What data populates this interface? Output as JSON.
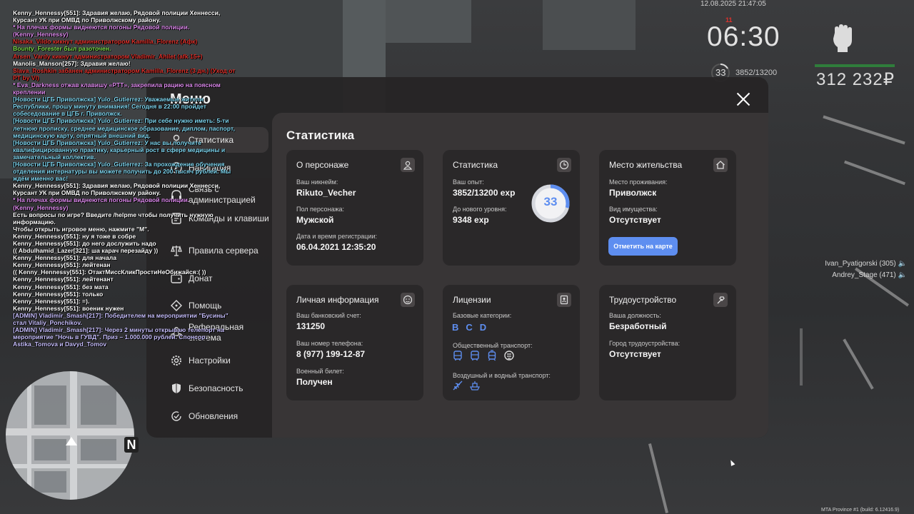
{
  "chat": [
    {
      "text": "Kenny_Hennessy[551]: Здравия желаю, Рядовой полиции Хеннесси, Курсант УК при ОМВД по Приволжскому району.",
      "color": "#ffffff"
    },
    {
      "text": "* На плечах формы виднеются погоны Рядовой полиции. (Kenny_Hennessy)",
      "color": "#e08cf0"
    },
    {
      "text": "Nisaka_Vildo кикнут администратором Kamilla_Florenz (Афк)",
      "color": "#e0322c"
    },
    {
      "text": "Bounty_Forester был разоточен.",
      "color": "#7ddc4a"
    },
    {
      "text": "Arsen_Vardy кикнут администратором Vladimir_Ahilet (afk 15+)",
      "color": "#e0322c"
    },
    {
      "text": "Manolis_Manson[257]: Здравия желаю!",
      "color": "#ffffff"
    },
    {
      "text": "Slava_Roshkin забанен администратором Kamilla_Florenz (3 дн.) (Уход от PT by VI)",
      "color": "#e0322c"
    },
    {
      "text": "* Eva_Darkness отжав клавишу «PTT», закрепила рацию на поясном креплении",
      "color": "#e08cf0"
    },
    {
      "text": "[Новости ЦГБ Приволжска] Yulo_Gutierrez: Уважаемые жители Республики, прошу минуту внимания! Сегодня в 22:00 пройдет собеседование в ЦГБ г. Приволжск.",
      "color": "#7fd6f0"
    },
    {
      "text": "[Новости ЦГБ Приволжска] Yulo_Gutierrez: При себе нужно иметь: 5-ти летнюю прописку, среднее медицинское образование, диплом, паспорт, медицинскую карту, опрятный внешний вид.",
      "color": "#7fd6f0"
    },
    {
      "text": "[Новости ЦГБ Приволжска] Yulo_Gutierrez: У нас вы получите квалифицированную практику, карьерный рост в сфере медицины и замечательный коллектив.",
      "color": "#7fd6f0"
    },
    {
      "text": "[Новости ЦГБ Приволжска] Yulo_Gutierrez: За прохождение обучения отделения интернатуры вы можете получить до 200 тысяч рублей. Мы ждём именно вас!",
      "color": "#7fd6f0"
    },
    {
      "text": "Kenny_Hennessy[551]: Здравия желаю, Рядовой полиции Хеннесси, Курсант УК при ОМВД по Приволжскому району.",
      "color": "#ffffff"
    },
    {
      "text": "* На плечах формы виднеются погоны Рядовой полиции. (Kenny_Hennessy)",
      "color": "#e08cf0"
    },
    {
      "text": "Есть вопросы по игре? Введите /helpme чтобы получить нужную информацию.",
      "color": "#ffffff"
    },
    {
      "text": "Чтобы открыть игровое меню, нажмите \"M\".",
      "color": "#ffffff"
    },
    {
      "text": "Kenny_Hennessy[551]: ну я тоже в собре",
      "color": "#ffffff"
    },
    {
      "text": "Kenny_Hennessy[551]: до него дослужить надо",
      "color": "#ffffff"
    },
    {
      "text": "(( Abdulhamid_Lazer[321]: ша карач перезайду ))",
      "color": "#ffffff"
    },
    {
      "text": "Kenny_Hennessy[551]: для начала",
      "color": "#ffffff"
    },
    {
      "text": "Kenny_Hennessy[551]: лейтенан",
      "color": "#ffffff"
    },
    {
      "text": "(( Kenny_Hennessy[551]: ОтактМиссКликПростиНеОбижайся:( ))",
      "color": "#ffffff"
    },
    {
      "text": "Kenny_Hennessy[551]: лейтенант",
      "color": "#ffffff"
    },
    {
      "text": "Kenny_Hennessy[551]: без мата",
      "color": "#ffffff"
    },
    {
      "text": "Kenny_Hennessy[551]: только",
      "color": "#ffffff"
    },
    {
      "text": "Kenny_Hennessy[551]: =).",
      "color": "#ffffff"
    },
    {
      "text": "Kenny_Hennessy[551]: военик нужен",
      "color": "#ffffff"
    },
    {
      "text": "[ADMIN] Vladimir_Smash[217]: Победителем на мероприятии \"Бусины\" стал Vitaliy_Ponchikov.",
      "color": "#c9c0ff"
    },
    {
      "text": "[ADMIN] Vladimir_Smash[217]: Через 2 минуты открываю телепорт на мероприятие \"Ночь в ГУВД\". Приз – 1.000.000 рублей. Спонсор: Astika_Tomova и Davyd_Tomov",
      "color": "#c9c0ff"
    }
  ],
  "hud": {
    "date": "12.08.2025 21:47:05",
    "time": "06:30",
    "red_counter": "11",
    "level": "33",
    "exp": "3852/13200",
    "money": "312 232₽",
    "players": [
      "Ivan_Pyatigorski (305)",
      "Andrey_Stage (471)"
    ],
    "build": "MTA Province #1 (build: 6.12416.9)"
  },
  "menu": {
    "title": "Меню",
    "nav": [
      {
        "label": "Статистика",
        "icon": "user-icon",
        "active": true
      },
      {
        "label": "Навигация",
        "icon": "compass-icon"
      },
      {
        "label": "Связь с администрацией",
        "icon": "headset-icon"
      },
      {
        "label": "Команды и клавиши",
        "icon": "keyboard-icon"
      },
      {
        "label": "Правила сервера",
        "icon": "scales-icon"
      },
      {
        "label": "Донат",
        "icon": "wallet-icon"
      },
      {
        "label": "Помощь",
        "icon": "help-icon"
      },
      {
        "label": "Реферальная система",
        "icon": "network-icon"
      },
      {
        "label": "Настройки",
        "icon": "gear-icon"
      },
      {
        "label": "Безопасность",
        "icon": "shield-icon"
      },
      {
        "label": "Обновления",
        "icon": "refresh-icon"
      }
    ]
  },
  "content": {
    "title": "Статистика",
    "character": {
      "title": "О персонаже",
      "icon": "person-icon",
      "nick_label": "Ваш никнейм:",
      "nick": "Rikuto_Vecher",
      "gender_label": "Пол персонажа:",
      "gender": "Мужской",
      "reg_label": "Дата и время регистрации:",
      "reg": "06.04.2021 12:35:20"
    },
    "stats": {
      "title": "Статистика",
      "icon": "clock-icon",
      "exp_label": "Ваш опыт:",
      "exp": "3852/13200 exp",
      "next_label": "До нового уровня:",
      "next": "9348 exp",
      "level": "33",
      "level_progress": 0.29
    },
    "residence": {
      "title": "Место жительства",
      "icon": "home-icon",
      "place_label": "Место проживания:",
      "place": "Приволжск",
      "property_label": "Вид имущества:",
      "property": "Отсутствует",
      "button": "Отметить на карте"
    },
    "personal": {
      "title": "Личная информация",
      "icon": "face-icon",
      "bank_label": "Ваш банковский счет:",
      "bank": "131250",
      "phone_label": "Ваш номер телефона:",
      "phone": "8 (977) 199-12-87",
      "military_label": "Военный билет:",
      "military": "Получен"
    },
    "licenses": {
      "title": "Лицензии",
      "icon": "id-card-icon",
      "base_label": "Базовые категории:",
      "base": [
        "B",
        "C",
        "D"
      ],
      "public_label": "Общественный транспорт:",
      "public_icons": [
        "bus-icon",
        "bus-icon",
        "tram-icon",
        "trolley-icon"
      ],
      "air_label": "Воздушный и водный транспорт:",
      "air_icons": [
        "plane-icon",
        "boat-icon"
      ]
    },
    "job": {
      "title": "Трудоустройство",
      "icon": "hammer-icon",
      "position_label": "Ваша должность:",
      "position": "Безработный",
      "city_label": "Город трудоустройства:",
      "city": "Отсутствует"
    }
  },
  "colors": {
    "accent": "#5e8ef0",
    "panel": "#2a2829",
    "content_bg": "#383536",
    "health": "#2f7d3b"
  }
}
